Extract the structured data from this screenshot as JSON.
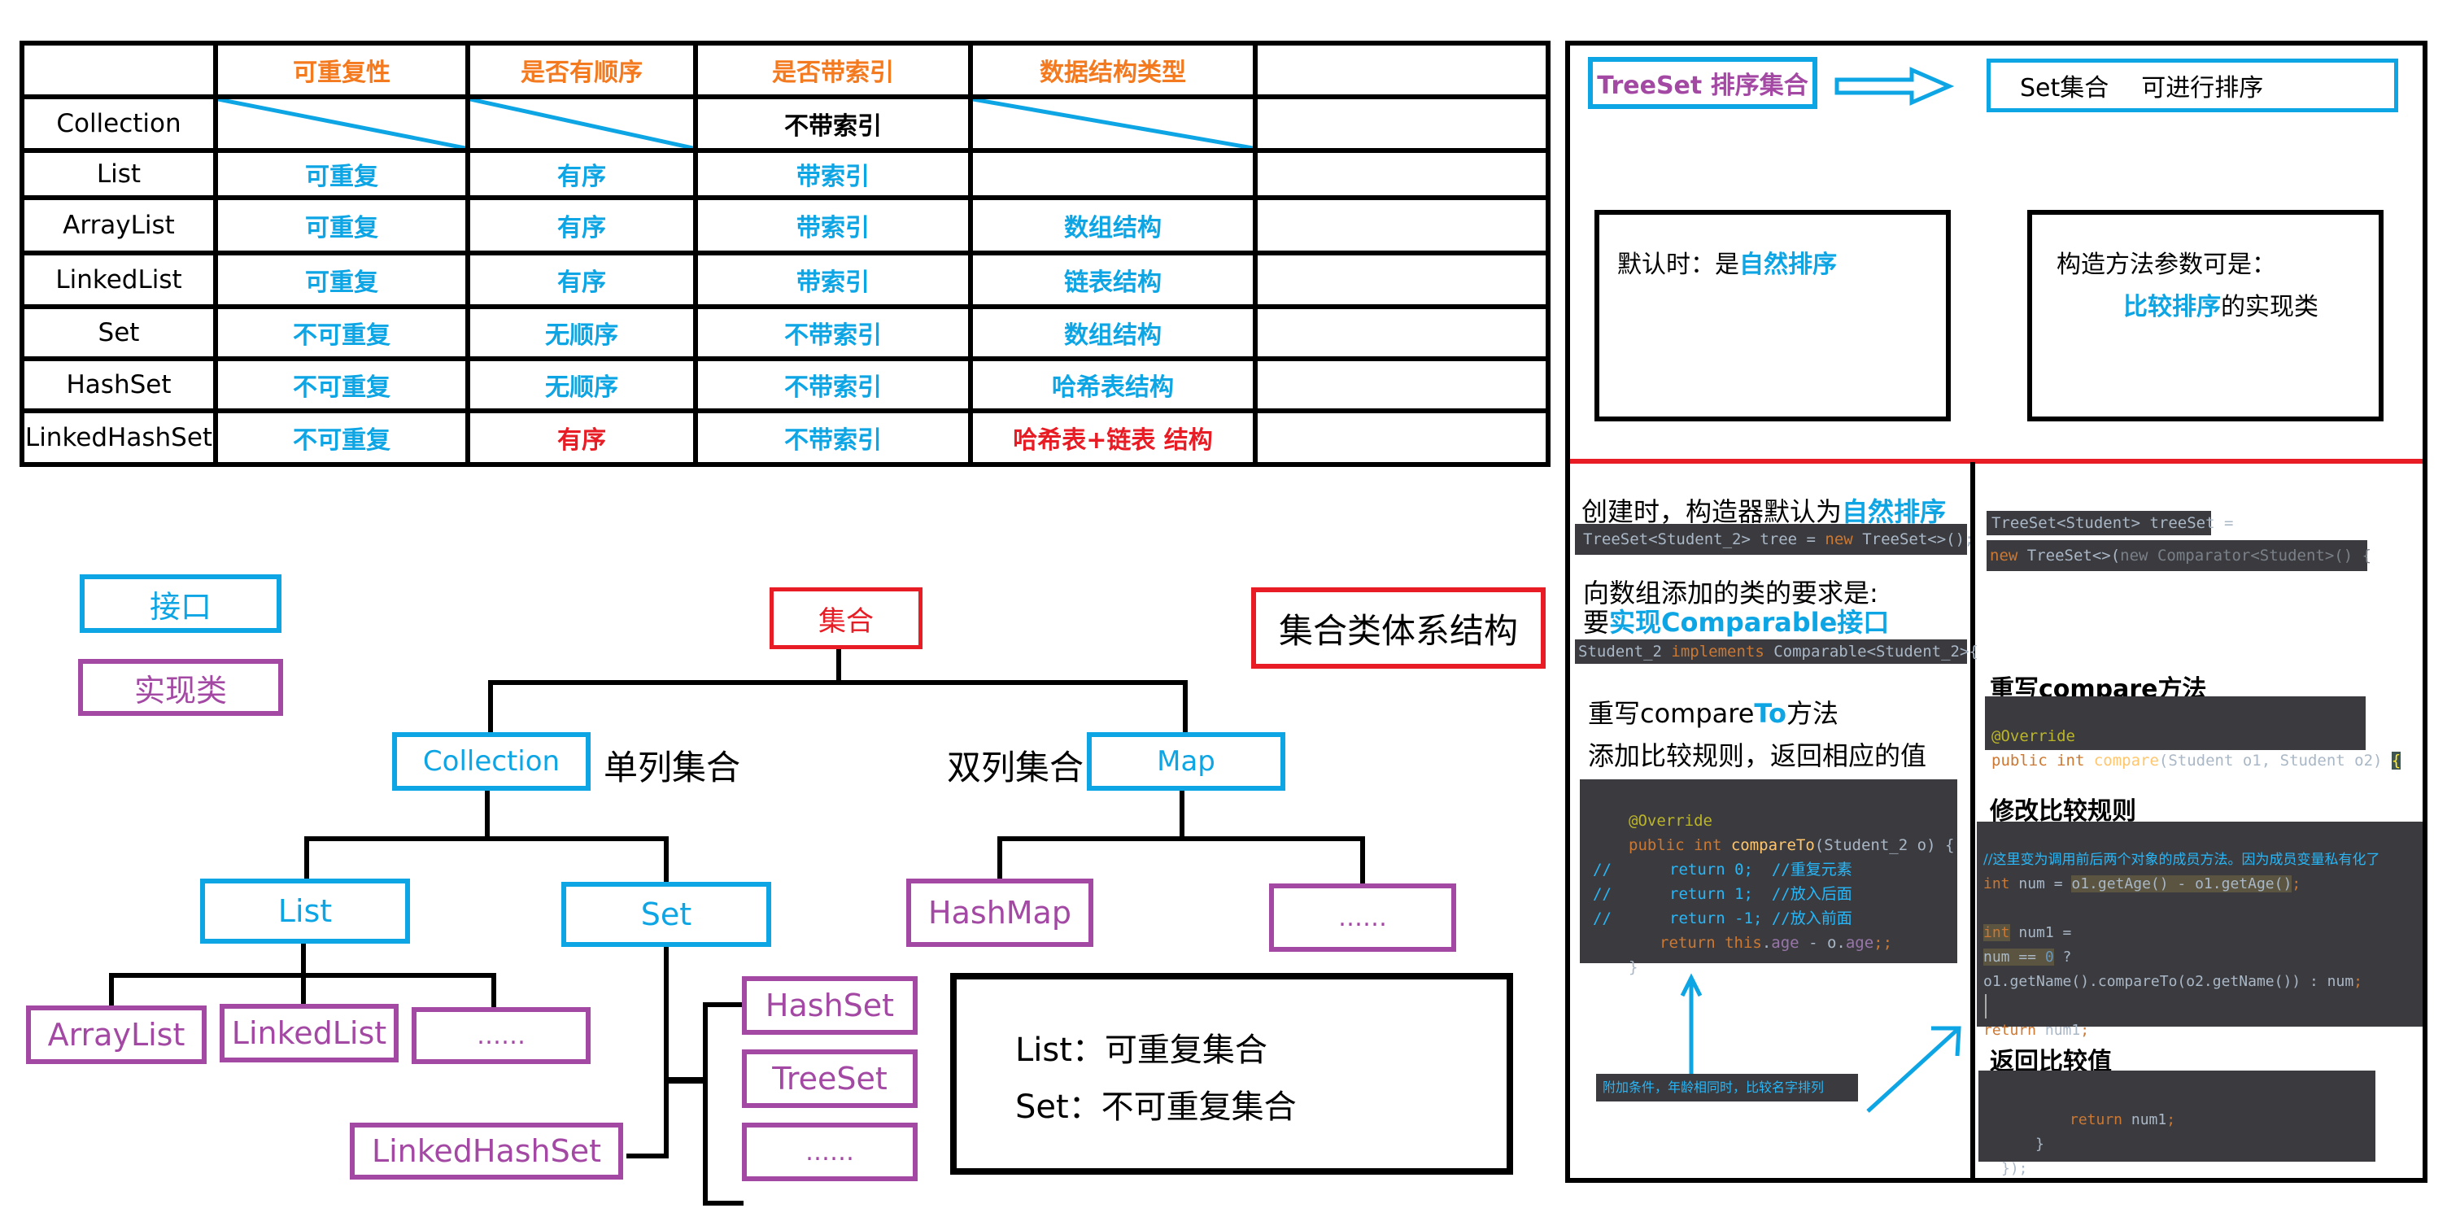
{
  "table": {
    "headers": [
      "",
      "可重复性",
      "是否有顺序",
      "是否带索引",
      "数据结构类型",
      ""
    ],
    "rows": [
      {
        "name": "Collection",
        "dup": "",
        "order": "",
        "index": "不带索引",
        "struct": "",
        "extra": "",
        "colors": {
          "index": "black"
        }
      },
      {
        "name": "List",
        "dup": "可重复",
        "order": "有序",
        "index": "带索引",
        "struct": "",
        "extra": ""
      },
      {
        "name": "ArrayList",
        "dup": "可重复",
        "order": "有序",
        "index": "带索引",
        "struct": "数组结构",
        "extra": ""
      },
      {
        "name": "LinkedList",
        "dup": "可重复",
        "order": "有序",
        "index": "带索引",
        "struct": "链表结构",
        "extra": ""
      },
      {
        "name": "Set",
        "dup": "不可重复",
        "order": "无顺序",
        "index": "不带索引",
        "struct": "数组结构",
        "extra": ""
      },
      {
        "name": "HashSet",
        "dup": "不可重复",
        "order": "无顺序",
        "index": "不带索引",
        "struct": "哈希表结构",
        "extra": ""
      },
      {
        "name": "LinkedHashSet",
        "dup": "不可重复",
        "order": "有序",
        "index": "不带索引",
        "struct": "哈希表+链表 结构",
        "extra": "",
        "colors": {
          "order": "red",
          "struct": "red"
        }
      }
    ]
  },
  "legend": {
    "interface": "接口",
    "impl_class": "实现类"
  },
  "hierarchy": {
    "title": "集合类体系结构",
    "root": "集合",
    "collection": "Collection",
    "collection_note": "单列集合",
    "map": "Map",
    "map_note": "双列集合",
    "list": "List",
    "set": "Set",
    "hashmap": "HashMap",
    "map_more": "……",
    "arraylist": "ArrayList",
    "linkedlist": "LinkedList",
    "list_more": "……",
    "hashset": "HashSet",
    "treeset": "TreeSet",
    "set_more": "……",
    "linkedhashset": "LinkedHashSet",
    "note_list": "List：可重复集合",
    "note_set": "Set：不可重复集合"
  },
  "treeset": {
    "title": "TreeSet 排序集合",
    "desc_a": "Set集合",
    "desc_b": "可进行排序",
    "default_prefix": "默认时：是",
    "default_highlight": "自然排序",
    "ctor_line1": "构造方法参数可是：",
    "ctor_highlight": "比较排序",
    "ctor_suffix": "的实现类"
  },
  "natural": {
    "heading_prefix": "创建时，构造器默认为",
    "heading_highlight": "自然排序",
    "code_create": {
      "a": "TreeSet<Student_2> tree = ",
      "kw": "new",
      "b": " TreeSet<>();"
    },
    "req_line1": "向数组添加的类的要求是:",
    "req_prefix": "要",
    "req_highlight": "实现Comparable接口",
    "code_impl": {
      "a": "Student_2 ",
      "kw": "implements",
      "b": " Comparable<Student_2>{"
    },
    "override_prefix": "重写compare",
    "override_highlight": "To",
    "override_suffix": "方法",
    "rule_line": "添加比较规则，返回相应的值",
    "code_compareTo": {
      "annotation": "@Override",
      "sig_kw": "public int ",
      "sig_fn": "compareTo",
      "sig_rest": "(Student_2 o) {",
      "lines": [
        {
          "gutter": "//",
          "code": "return 0;",
          "comment": "//重复元素"
        },
        {
          "gutter": "//",
          "code": "return 1;",
          "comment": "//放入后面"
        },
        {
          "gutter": "//",
          "code": "return -1;",
          "comment": "//放入前面"
        }
      ],
      "ret_kw": "return ",
      "ret_this": "this",
      "ret_dot": ".",
      "ret_field": "age",
      "ret_mid": " - o.",
      "ret_field2": "age",
      "ret_end": ";;",
      "close": "}"
    },
    "note": "附加条件，年龄相同时，比较名字排列"
  },
  "comparator": {
    "code_decl": "TreeSet<Student> treeSet =",
    "code_new": {
      "kw": "new",
      "a": " TreeSet<>(",
      "kw2": "new",
      "b": " Comparator<Student>() {"
    },
    "override_heading": "重写compare方法",
    "code_override": {
      "annotation": "@Override",
      "sig_kw": "public int ",
      "sig_fn": "compare",
      "sig_rest": "(Student o1, Student o2) ",
      "brace": "{"
    },
    "modify_heading": "修改比较规则",
    "code_rule": {
      "comment": "//这里变为调用前后两个对象的成员方法。因为成员变量私有化了",
      "l1_kw": "int",
      "l1_a": " num = ",
      "l1_hl": "o1.getAge() - o1.getAge()",
      "l1_end": ";",
      "l2_kw": "int",
      "l2_a": " num1 =",
      "l3_a": "num == ",
      "l3_num": "0",
      "l3_b": " ?",
      "l4": "o1.getName().compareTo(o2.getName()) : num",
      "l4_end": ";",
      "l5_kw": "return",
      "l5_a": " num1",
      "l5_end": ";"
    },
    "return_heading": "返回比较值",
    "code_return": {
      "kw": "return",
      "a": " num1",
      "end": ";",
      "close1": "}",
      "close2": "});"
    }
  },
  "colors": {
    "interface": "#0ea5e5",
    "implementation": "#a349a4",
    "header_orange": "#f47a20",
    "highlight_red": "#e81c24",
    "code_bg": "#3b3b3f"
  }
}
